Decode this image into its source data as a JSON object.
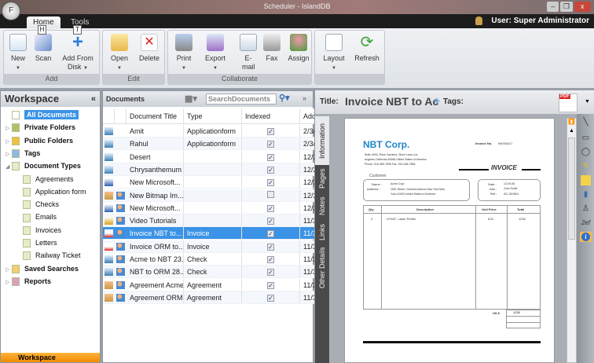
{
  "window": {
    "title": "Scheduler - IslandDB"
  },
  "app_button": {
    "label": "F"
  },
  "ribbon_tabs": [
    {
      "label": "Home",
      "keytip": "H"
    },
    {
      "label": "Tools",
      "keytip": "T"
    }
  ],
  "user": {
    "label": "User: Super Administrator"
  },
  "ribbon": {
    "groups": [
      {
        "label": "Add",
        "buttons": [
          {
            "label": "New"
          },
          {
            "label": "Scan"
          },
          {
            "label": "Add From Disk"
          }
        ]
      },
      {
        "label": "Edit",
        "buttons": [
          {
            "label": "Open"
          },
          {
            "label": "Delete"
          }
        ]
      },
      {
        "label": "Collaborate",
        "buttons": [
          {
            "label": "Print"
          },
          {
            "label": "Export"
          },
          {
            "label": "E-mail"
          },
          {
            "label": "Fax"
          },
          {
            "label": "Assign"
          }
        ]
      },
      {
        "label": "",
        "buttons": [
          {
            "label": "Layout"
          },
          {
            "label": "Refresh"
          }
        ]
      }
    ]
  },
  "workspace": {
    "title": "Workspace",
    "collapse": "«",
    "items": [
      {
        "label": "All Documents"
      },
      {
        "label": "Private Folders"
      },
      {
        "label": "Public Folders"
      },
      {
        "label": "Tags"
      },
      {
        "label": "Document Types"
      },
      {
        "label": "Agreements"
      },
      {
        "label": "Application form"
      },
      {
        "label": "Checks"
      },
      {
        "label": "Emails"
      },
      {
        "label": "Invoices"
      },
      {
        "label": "Letters"
      },
      {
        "label": "Railway Ticket"
      },
      {
        "label": "Saved Searches"
      },
      {
        "label": "Reports"
      }
    ],
    "bottom_tab": "Workspace"
  },
  "documents": {
    "title": "Documents",
    "search_placeholder": "SearchDocuments",
    "columns": [
      "Document Title",
      "Type",
      "Indexed",
      "Add"
    ],
    "rows": [
      {
        "title": "Amit",
        "type": "Applicationform",
        "indexed": true,
        "added": "2/3/"
      },
      {
        "title": "Rahul",
        "type": "Applicationform",
        "indexed": true,
        "added": "2/3/"
      },
      {
        "title": "Desert",
        "type": "",
        "indexed": true,
        "added": "12/2"
      },
      {
        "title": "Chrysanthemum",
        "type": "",
        "indexed": true,
        "added": "12/2"
      },
      {
        "title": "New Microsoft...",
        "type": "",
        "indexed": true,
        "added": "12/2"
      },
      {
        "title": "New Bitmap Im...",
        "type": "",
        "indexed": false,
        "added": "12/2"
      },
      {
        "title": "New Microsoft...",
        "type": "",
        "indexed": true,
        "added": "12/2"
      },
      {
        "title": "Video Tutorials",
        "type": "",
        "indexed": true,
        "added": "11/3"
      },
      {
        "title": "Invoice NBT to...",
        "type": "Invoice",
        "indexed": true,
        "added": "11/3"
      },
      {
        "title": "Invoice ORM to...",
        "type": "Invoice",
        "indexed": true,
        "added": "11/3"
      },
      {
        "title": "Acme to NBT 23...",
        "type": "Check",
        "indexed": true,
        "added": "11/3"
      },
      {
        "title": "NBT to ORM 28...",
        "type": "Check",
        "indexed": true,
        "added": "11/3"
      },
      {
        "title": "Agreement Acme",
        "type": "Agreement",
        "indexed": true,
        "added": "11/3"
      },
      {
        "title": "Agreement ORM",
        "type": "Agreement",
        "indexed": true,
        "added": "11/3"
      }
    ],
    "selected_index": 8
  },
  "viewer": {
    "title_label": "Title:",
    "title_value": "Invoice NBT to Ac",
    "tags_label": "Tags:",
    "pdf_badge": "PDF",
    "side_tabs": [
      "Information",
      "Pages",
      "Notes",
      "Links",
      "Other Details"
    ],
    "invoice": {
      "company": "NBT Corp.",
      "address1": "Suite 4094, Rose Gardens, Silver Lane,Los",
      "address2": "Angeles,California,90058,United States of America",
      "phone": "Phone: 916-456-7895    Fax: 916-456-7896",
      "invoice_no_label": "Invoice No.",
      "invoice_no": "INV00A17",
      "heading": "INVOICE",
      "customer_label": "Customer",
      "name_label": "Name :",
      "name": "Acme Corp",
      "address_label": "Address :",
      "cust_address": "1501 Street, Orchard Avenue,New York,New York,10409,United States of America",
      "date_label": "Date :",
      "date": "12-09-08",
      "attn_label": "Attn :",
      "attn": "John Smith",
      "ref_label": "Ref :",
      "ref": "AC-00XB4",
      "columns": [
        "Qty",
        "Description",
        "Unit Price",
        "Total"
      ],
      "line": {
        "qty": "2",
        "desc": "LPX87- Laser Printer",
        "unit": "615",
        "total": "1230"
      },
      "currency_label": "US $",
      "grand_total": "1230"
    }
  }
}
